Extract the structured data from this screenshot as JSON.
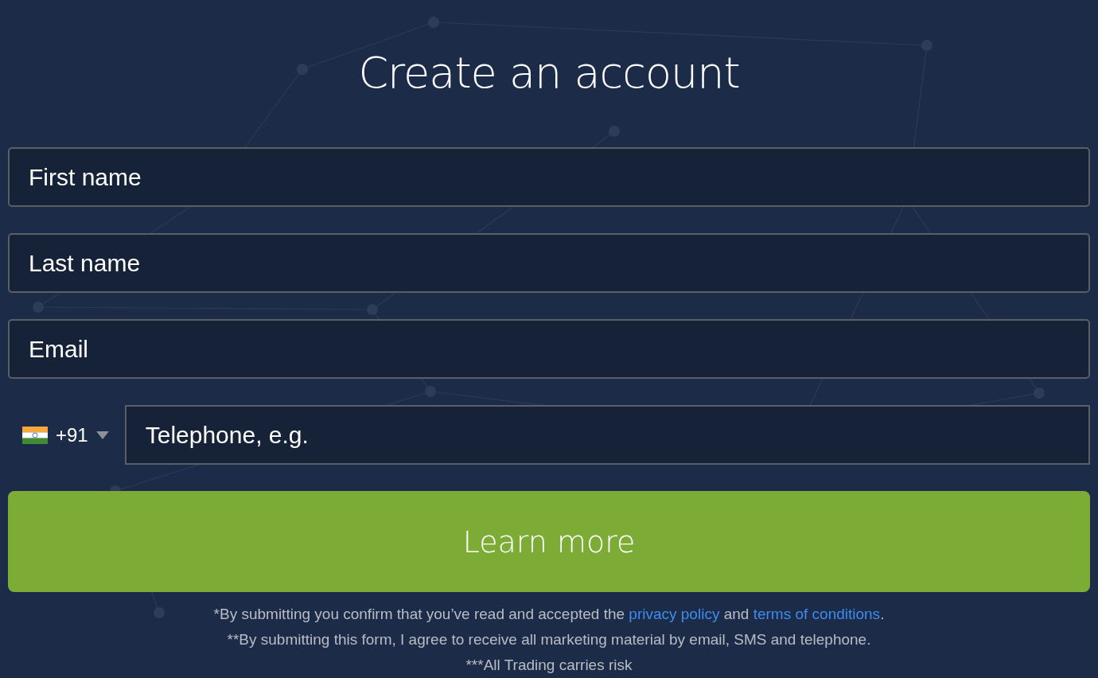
{
  "title": "Create an account",
  "fields": [
    {
      "placeholder": "First name"
    },
    {
      "placeholder": "Last name"
    },
    {
      "placeholder": "Email"
    }
  ],
  "phone": {
    "country_code": "+91",
    "placeholder": "Telephone, e.g."
  },
  "submit_button": "Learn more",
  "disclaimers": [
    [
      {
        "kind": "text",
        "text": "*By submitting you confirm that you’ve read and accepted the "
      },
      {
        "kind": "link",
        "text": "privacy policy"
      },
      {
        "kind": "text",
        "text": " and "
      },
      {
        "kind": "link",
        "text": "terms of conditions"
      },
      {
        "kind": "text",
        "text": "."
      }
    ],
    [
      {
        "kind": "text",
        "text": "**By submitting this form, I agree to receive all marketing material by email, SMS and telephone."
      }
    ],
    [
      {
        "kind": "text",
        "text": "***All Trading carries risk"
      }
    ]
  ]
}
